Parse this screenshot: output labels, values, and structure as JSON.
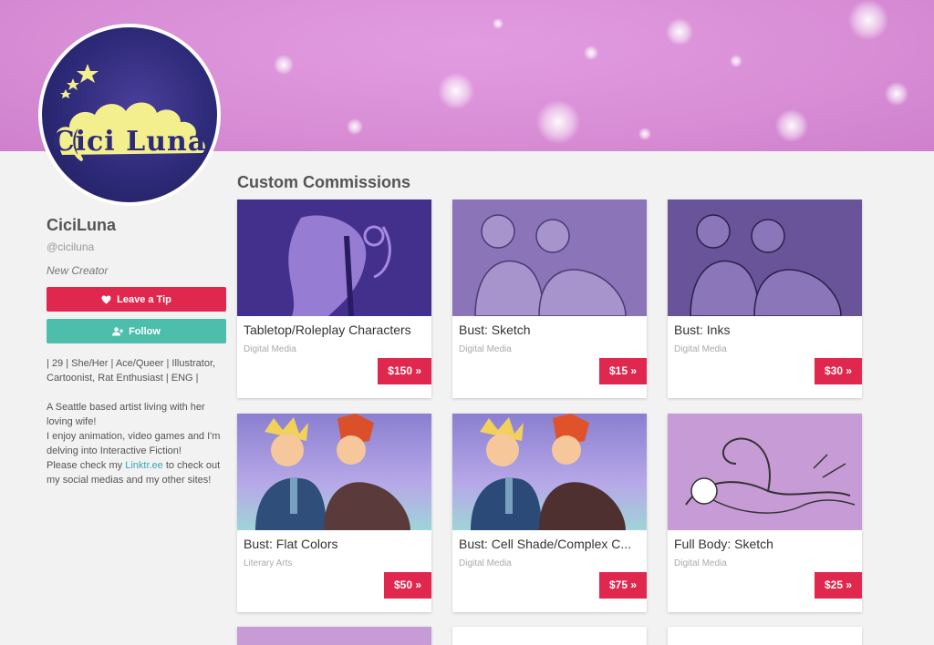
{
  "profile": {
    "name": "CiciLuna",
    "handle": "@ciciluna",
    "role": "New Creator",
    "logo_text": "Cici Luna",
    "tip_label": "Leave a Tip",
    "follow_label": "Follow",
    "tags": "| 29 | She/Her | Ace/Queer | Illustrator, Cartoonist, Rat Enthusiast | ENG |",
    "bio_line1": "A Seattle based artist living with her loving wife!",
    "bio_line2": "I enjoy animation, video games and I'm delving into Interactive Fiction!",
    "bio_line3_prefix": "Please check my ",
    "bio_link": "Linktr.ee",
    "bio_line3_suffix": " to check out my social medias and my other sites!"
  },
  "section_title": "Custom Commissions",
  "commissions": [
    {
      "title": "Tabletop/Roleplay Characters",
      "category": "Digital Media",
      "price": "$150 »"
    },
    {
      "title": "Bust: Sketch",
      "category": "Digital Media",
      "price": "$15 »"
    },
    {
      "title": "Bust: Inks",
      "category": "Digital Media",
      "price": "$30 »"
    },
    {
      "title": "Bust: Flat Colors",
      "category": "Literary Arts",
      "price": "$50 »"
    },
    {
      "title": "Bust: Cell Shade/Complex C...",
      "category": "Digital Media",
      "price": "$75 »"
    },
    {
      "title": "Full Body: Sketch",
      "category": "Digital Media",
      "price": "$25 »"
    }
  ],
  "colors": {
    "accent_red": "#e0284f",
    "follow_teal": "#4dbdac",
    "banner_pink": "#d98fd6",
    "link_teal": "#3aa7b6"
  },
  "icons": {
    "tip": "heart-icon",
    "follow": "user-plus-icon"
  }
}
